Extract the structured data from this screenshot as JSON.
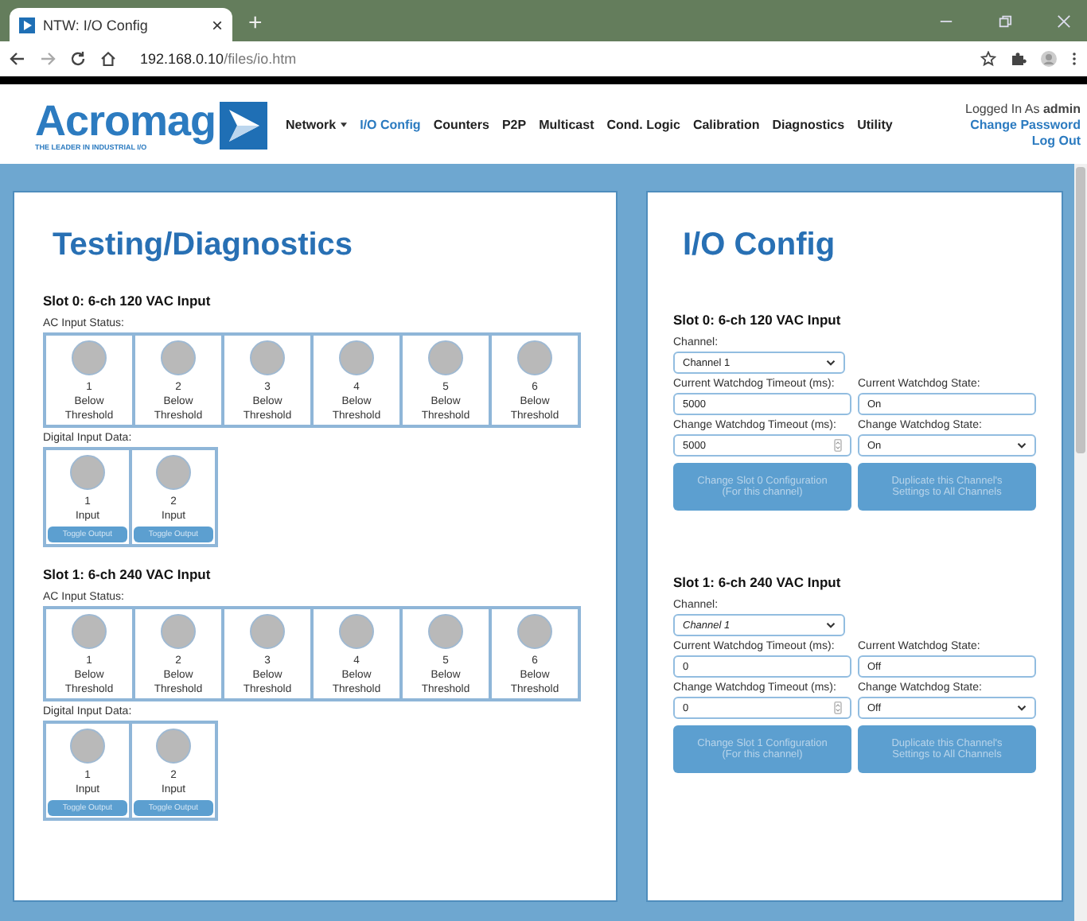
{
  "browser": {
    "tab_title": "NTW: I/O Config",
    "tab_close": "×",
    "new_tab": "+",
    "url_host": "192.168.0.10",
    "url_path": "/files/io.htm"
  },
  "header": {
    "logo": "Acromag",
    "tagline": "THE LEADER IN INDUSTRIAL I/O",
    "nav": [
      {
        "label": "Network",
        "dropdown": true,
        "selected": false
      },
      {
        "label": "I/O Config",
        "dropdown": false,
        "selected": true
      },
      {
        "label": "Counters",
        "dropdown": false,
        "selected": false
      },
      {
        "label": "P2P",
        "dropdown": false,
        "selected": false
      },
      {
        "label": "Multicast",
        "dropdown": false,
        "selected": false
      },
      {
        "label": "Cond. Logic",
        "dropdown": false,
        "selected": false
      },
      {
        "label": "Calibration",
        "dropdown": false,
        "selected": false
      },
      {
        "label": "Diagnostics",
        "dropdown": false,
        "selected": false
      },
      {
        "label": "Utility",
        "dropdown": false,
        "selected": false
      }
    ],
    "user": "Logged In As **admin**",
    "links": [
      "Change Password",
      "Log Out"
    ]
  },
  "diagnostics": {
    "title": "Testing/Diagnostics",
    "slots": [
      {
        "title": "Slot 0: 6-ch 120 VAC Input",
        "ac_label": "AC Input Status:",
        "ac_channels": [
          {
            "number": "1",
            "status": "Below Threshold",
            "on": false
          },
          {
            "number": "2",
            "status": "Below Threshold",
            "on": false
          },
          {
            "number": "3",
            "status": "Below Threshold",
            "on": false
          },
          {
            "number": "4",
            "status": "Below Threshold",
            "on": false
          },
          {
            "number": "5",
            "status": "Below Threshold",
            "on": false
          },
          {
            "number": "6",
            "status": "Below Threshold",
            "on": false
          }
        ],
        "di_label": "Digital Input Data:",
        "di_channels": [
          {
            "number": "1",
            "label": "Input",
            "on": false,
            "button": "Toggle Output"
          },
          {
            "number": "2",
            "label": "Input",
            "on": false,
            "button": "Toggle Output"
          }
        ]
      },
      {
        "title": "Slot 1: 6-ch 240 VAC Input",
        "ac_label": "AC Input Status:",
        "ac_channels": [
          {
            "number": "1",
            "status": "Below Threshold",
            "on": false
          },
          {
            "number": "2",
            "status": "Below Threshold",
            "on": false
          },
          {
            "number": "3",
            "status": "Below Threshold",
            "on": false
          },
          {
            "number": "4",
            "status": "Below Threshold",
            "on": false
          },
          {
            "number": "5",
            "status": "Below Threshold",
            "on": false
          },
          {
            "number": "6",
            "status": "Below Threshold",
            "on": false
          }
        ],
        "di_label": "Digital Input Data:",
        "di_channels": [
          {
            "number": "1",
            "label": "Input",
            "on": false,
            "button": "Toggle Output"
          },
          {
            "number": "2",
            "label": "Input",
            "on": false,
            "button": "Toggle Output"
          }
        ]
      }
    ]
  },
  "config": {
    "title": "I/O Config",
    "slots": [
      {
        "title": "Slot 0: 6-ch 120 VAC Input",
        "channel_label": "Channel:",
        "channel": "Channel 1",
        "current_timeout_label": "Current Watchdog Timeout (ms):",
        "current_timeout": "5000",
        "current_state_label": "Current Watchdog State:",
        "current_state": "On",
        "change_timeout_label": "Change Watchdog Timeout (ms):",
        "change_timeout": "5000",
        "change_state_label": "Change Watchdog State:",
        "change_state": "On",
        "buttons": [
          {
            "label": "Change Slot 0 Configuration (For this channel)",
            "disabled": true
          },
          {
            "label": "Duplicate this Channel's Settings to All Channels",
            "disabled": true
          }
        ]
      },
      {
        "title": "Slot 1: 6-ch 240 VAC Input",
        "channel_label": "Channel:",
        "channel": "Channel 1",
        "current_timeout_label": "Current Watchdog Timeout (ms):",
        "current_timeout": "0",
        "current_state_label": "Current Watchdog State:",
        "current_state": "Off",
        "change_timeout_label": "Change Watchdog Timeout (ms):",
        "change_timeout": "0",
        "change_state_label": "Change Watchdog State:",
        "change_state": "Off",
        "buttons": [
          {
            "label": "Change Slot 1 Configuration (For this channel)",
            "disabled": true
          },
          {
            "label": "Duplicate this Channel's Settings to All Channels",
            "disabled": true
          }
        ]
      }
    ]
  }
}
